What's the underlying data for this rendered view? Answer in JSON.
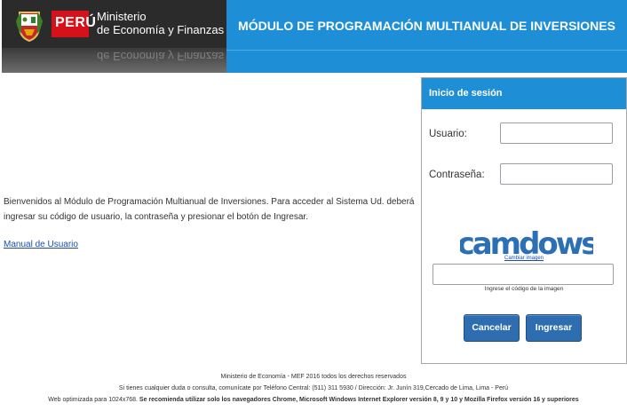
{
  "header": {
    "logo_country": "PERÚ",
    "logo_ministry_line1": "Ministerio",
    "logo_ministry_line2": "de Economía y Finanzas",
    "logo_reflection": "de Economía y Finanzas",
    "banner_title": "MÓDULO DE PROGRAMACIÓN MULTIANUAL DE INVERSIONES"
  },
  "main": {
    "welcome_text": "Bienvenidos al Módulo de Programación Multianual de Inversiones. Para acceder al Sistema Ud. deberá ingresar su código de usuario, la contraseña y presionar el botón de Ingresar.",
    "manual_link": "Manual de Usuario"
  },
  "login": {
    "title": "Inicio de sesión",
    "username_label": "Usuario:",
    "username_value": "",
    "password_label": "Contraseña:",
    "password_value": "",
    "captcha_text": "camdows",
    "change_image_link": "Cambiar imagen",
    "captcha_value": "",
    "captcha_instruction": "Ingrese el código de la imagen",
    "cancel_label": "Cancelar",
    "submit_label": "Ingresar"
  },
  "footer": {
    "line1": "Ministerio de Economía - MEF 2016 todos los derechos reservados",
    "line2": "Si tienes cualquier duda o consulta, comunícate por Teléfono Central: (511) 311 5930 / Dirección: Jr. Junín 319,Cercado de Lima, Lima - Perú",
    "line3_prefix": "Web optimizada para 1024x768.",
    "line3_bold": "Se recomienda utilizar solo los navegadores Chrome, Microsoft Windows Internet Explorer versión 8, 9 y 10 y Mozilla Firefox versión 16 y superiores"
  },
  "colors": {
    "banner_blue": "#1e8fd6",
    "button_blue": "#2e6db0",
    "peru_red": "#d6111a",
    "link_blue": "#1a4fa8"
  }
}
